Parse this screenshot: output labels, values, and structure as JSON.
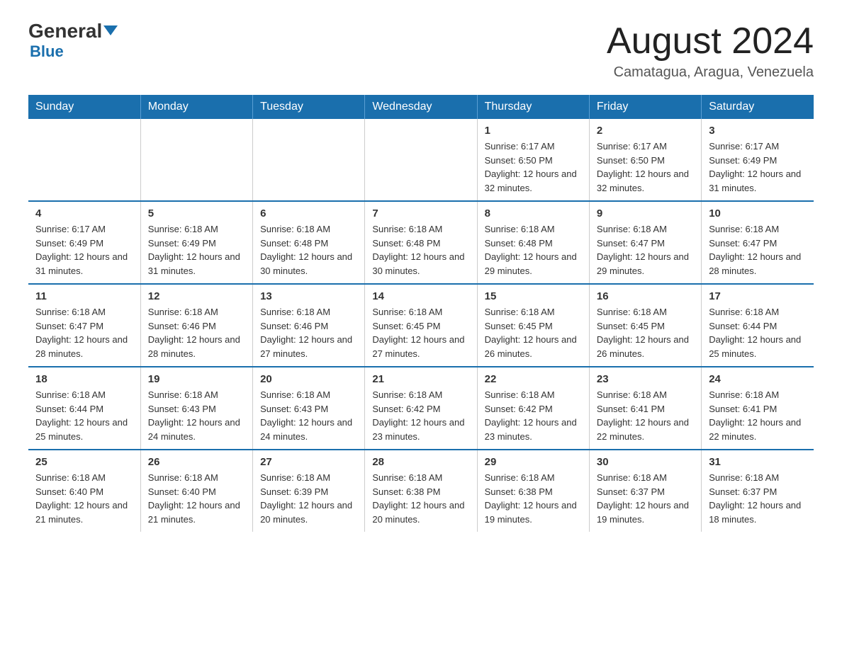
{
  "header": {
    "logo": {
      "general": "General",
      "blue": "Blue",
      "tagline": ""
    },
    "title": "August 2024",
    "location": "Camatagua, Aragua, Venezuela"
  },
  "days_of_week": [
    "Sunday",
    "Monday",
    "Tuesday",
    "Wednesday",
    "Thursday",
    "Friday",
    "Saturday"
  ],
  "weeks": [
    [
      {
        "day": "",
        "info": ""
      },
      {
        "day": "",
        "info": ""
      },
      {
        "day": "",
        "info": ""
      },
      {
        "day": "",
        "info": ""
      },
      {
        "day": "1",
        "info": "Sunrise: 6:17 AM\nSunset: 6:50 PM\nDaylight: 12 hours and 32 minutes."
      },
      {
        "day": "2",
        "info": "Sunrise: 6:17 AM\nSunset: 6:50 PM\nDaylight: 12 hours and 32 minutes."
      },
      {
        "day": "3",
        "info": "Sunrise: 6:17 AM\nSunset: 6:49 PM\nDaylight: 12 hours and 31 minutes."
      }
    ],
    [
      {
        "day": "4",
        "info": "Sunrise: 6:17 AM\nSunset: 6:49 PM\nDaylight: 12 hours and 31 minutes."
      },
      {
        "day": "5",
        "info": "Sunrise: 6:18 AM\nSunset: 6:49 PM\nDaylight: 12 hours and 31 minutes."
      },
      {
        "day": "6",
        "info": "Sunrise: 6:18 AM\nSunset: 6:48 PM\nDaylight: 12 hours and 30 minutes."
      },
      {
        "day": "7",
        "info": "Sunrise: 6:18 AM\nSunset: 6:48 PM\nDaylight: 12 hours and 30 minutes."
      },
      {
        "day": "8",
        "info": "Sunrise: 6:18 AM\nSunset: 6:48 PM\nDaylight: 12 hours and 29 minutes."
      },
      {
        "day": "9",
        "info": "Sunrise: 6:18 AM\nSunset: 6:47 PM\nDaylight: 12 hours and 29 minutes."
      },
      {
        "day": "10",
        "info": "Sunrise: 6:18 AM\nSunset: 6:47 PM\nDaylight: 12 hours and 28 minutes."
      }
    ],
    [
      {
        "day": "11",
        "info": "Sunrise: 6:18 AM\nSunset: 6:47 PM\nDaylight: 12 hours and 28 minutes."
      },
      {
        "day": "12",
        "info": "Sunrise: 6:18 AM\nSunset: 6:46 PM\nDaylight: 12 hours and 28 minutes."
      },
      {
        "day": "13",
        "info": "Sunrise: 6:18 AM\nSunset: 6:46 PM\nDaylight: 12 hours and 27 minutes."
      },
      {
        "day": "14",
        "info": "Sunrise: 6:18 AM\nSunset: 6:45 PM\nDaylight: 12 hours and 27 minutes."
      },
      {
        "day": "15",
        "info": "Sunrise: 6:18 AM\nSunset: 6:45 PM\nDaylight: 12 hours and 26 minutes."
      },
      {
        "day": "16",
        "info": "Sunrise: 6:18 AM\nSunset: 6:45 PM\nDaylight: 12 hours and 26 minutes."
      },
      {
        "day": "17",
        "info": "Sunrise: 6:18 AM\nSunset: 6:44 PM\nDaylight: 12 hours and 25 minutes."
      }
    ],
    [
      {
        "day": "18",
        "info": "Sunrise: 6:18 AM\nSunset: 6:44 PM\nDaylight: 12 hours and 25 minutes."
      },
      {
        "day": "19",
        "info": "Sunrise: 6:18 AM\nSunset: 6:43 PM\nDaylight: 12 hours and 24 minutes."
      },
      {
        "day": "20",
        "info": "Sunrise: 6:18 AM\nSunset: 6:43 PM\nDaylight: 12 hours and 24 minutes."
      },
      {
        "day": "21",
        "info": "Sunrise: 6:18 AM\nSunset: 6:42 PM\nDaylight: 12 hours and 23 minutes."
      },
      {
        "day": "22",
        "info": "Sunrise: 6:18 AM\nSunset: 6:42 PM\nDaylight: 12 hours and 23 minutes."
      },
      {
        "day": "23",
        "info": "Sunrise: 6:18 AM\nSunset: 6:41 PM\nDaylight: 12 hours and 22 minutes."
      },
      {
        "day": "24",
        "info": "Sunrise: 6:18 AM\nSunset: 6:41 PM\nDaylight: 12 hours and 22 minutes."
      }
    ],
    [
      {
        "day": "25",
        "info": "Sunrise: 6:18 AM\nSunset: 6:40 PM\nDaylight: 12 hours and 21 minutes."
      },
      {
        "day": "26",
        "info": "Sunrise: 6:18 AM\nSunset: 6:40 PM\nDaylight: 12 hours and 21 minutes."
      },
      {
        "day": "27",
        "info": "Sunrise: 6:18 AM\nSunset: 6:39 PM\nDaylight: 12 hours and 20 minutes."
      },
      {
        "day": "28",
        "info": "Sunrise: 6:18 AM\nSunset: 6:38 PM\nDaylight: 12 hours and 20 minutes."
      },
      {
        "day": "29",
        "info": "Sunrise: 6:18 AM\nSunset: 6:38 PM\nDaylight: 12 hours and 19 minutes."
      },
      {
        "day": "30",
        "info": "Sunrise: 6:18 AM\nSunset: 6:37 PM\nDaylight: 12 hours and 19 minutes."
      },
      {
        "day": "31",
        "info": "Sunrise: 6:18 AM\nSunset: 6:37 PM\nDaylight: 12 hours and 18 minutes."
      }
    ]
  ]
}
